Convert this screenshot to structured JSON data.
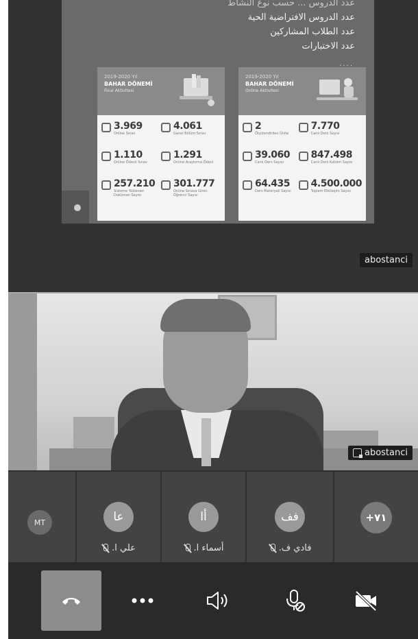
{
  "shared_screen": {
    "slide_lines": [
      "عدد الدروس الافتراضية الحية",
      "عدد الطلاب المشاركين",
      "عدد الاختبارات"
    ],
    "slide_line_cut": "عدد الدروس ... حسب نوع النشاط",
    "dots": "....",
    "poster_left": {
      "year": "2019-2020 Yıl",
      "title": "BAHAR DÖNEMİ",
      "subtitle": "Final Aktivitesi",
      "stats": [
        {
          "value": "3.969",
          "caption": "Online Sınav"
        },
        {
          "value": "4.061",
          "caption": "Genel Bölüm Sınav"
        },
        {
          "value": "1.110",
          "caption": "Online Ödevli Sınav"
        },
        {
          "value": "1.291",
          "caption": "Online Araştırma Ödevi"
        },
        {
          "value": "257.210",
          "caption": "Sisteme Yüklenen Doküman Sayısı"
        },
        {
          "value": "301.777",
          "caption": "Online Sınava Giren Öğrenci Sayısı"
        }
      ]
    },
    "poster_right": {
      "year": "2019-2020 Yıl",
      "title": "BAHAR DÖNEMİ",
      "subtitle": "Online Aktivitesi",
      "stats": [
        {
          "value": "2",
          "caption": "Ölçülendirilen Ünite"
        },
        {
          "value": "7.770",
          "caption": "Canlı Ders Sayısı"
        },
        {
          "value": "39.060",
          "caption": "Canlı Ders Sayısı"
        },
        {
          "value": "847.498",
          "caption": "Canlı Ders Katılım Sayısı"
        },
        {
          "value": "64.435",
          "caption": "Ders Materyali Sayısı"
        },
        {
          "value": "4.500.000",
          "caption": "Toplam Etkileşim Sayısı"
        }
      ]
    },
    "presenter_tag": "abostanci"
  },
  "video": {
    "name_tag": "abostanci"
  },
  "participants": [
    {
      "initials": "MT",
      "name": ""
    },
    {
      "initials": "عا",
      "name": "علي ا."
    },
    {
      "initials": "أا",
      "name": "أسماء ا."
    },
    {
      "initials": "فف",
      "name": "فادي ف."
    },
    {
      "initials": "+٧١",
      "name": ""
    }
  ],
  "controls": {
    "hangup": "hangup-icon",
    "more": "more-icon",
    "speaker": "speaker-icon",
    "mic": "mic-muted-icon",
    "camera": "camera-off-icon"
  },
  "colors": {
    "background": "#2e2e2e",
    "hangup_button": "#8c8c8c",
    "avatar": "#9a9a9a"
  }
}
